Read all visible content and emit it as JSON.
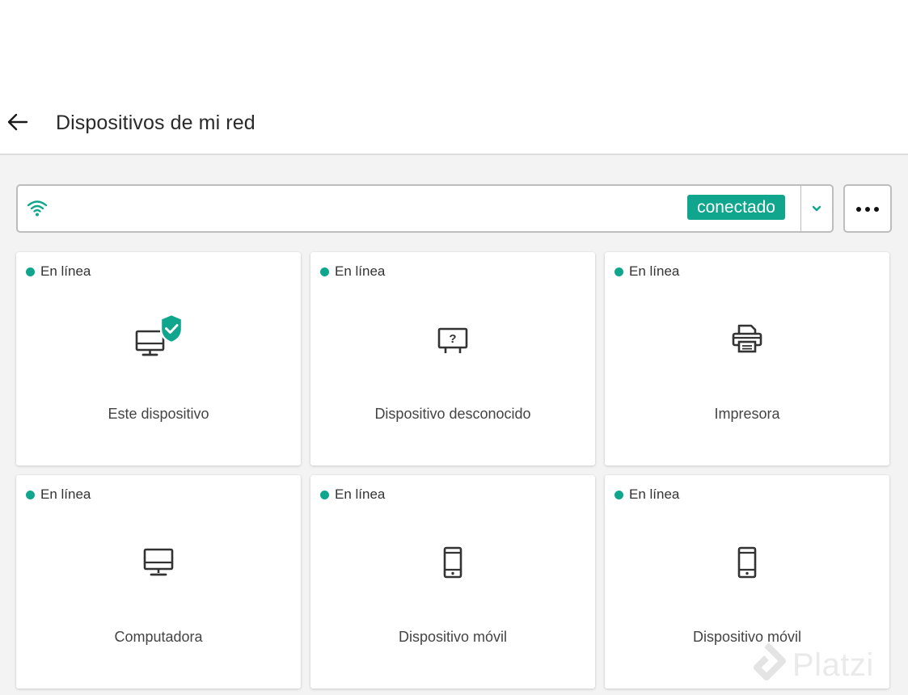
{
  "header": {
    "back_icon": "arrow-left-icon",
    "title": "Dispositivos de mi red"
  },
  "network": {
    "wifi_icon": "wifi-icon",
    "status": "conectado",
    "dropdown_icon": "chevron-down-icon",
    "more_icon": "more-horizontal-icon"
  },
  "devices": [
    {
      "status": "En línea",
      "label": "Este dispositivo",
      "icon": "computer-shield-icon"
    },
    {
      "status": "En línea",
      "label": "Dispositivo desconocido",
      "icon": "unknown-device-icon"
    },
    {
      "status": "En línea",
      "label": "Impresora",
      "icon": "printer-icon"
    },
    {
      "status": "En línea",
      "label": "Computadora",
      "icon": "computer-icon"
    },
    {
      "status": "En línea",
      "label": "Dispositivo móvil",
      "icon": "mobile-icon"
    },
    {
      "status": "En línea",
      "label": "Dispositivo móvil",
      "icon": "mobile-icon"
    }
  ],
  "watermark": {
    "text": "Platzi"
  },
  "colors": {
    "accent": "#10a58d",
    "background": "#f3f3f3",
    "card": "#ffffff",
    "border": "#bdbdbd"
  }
}
